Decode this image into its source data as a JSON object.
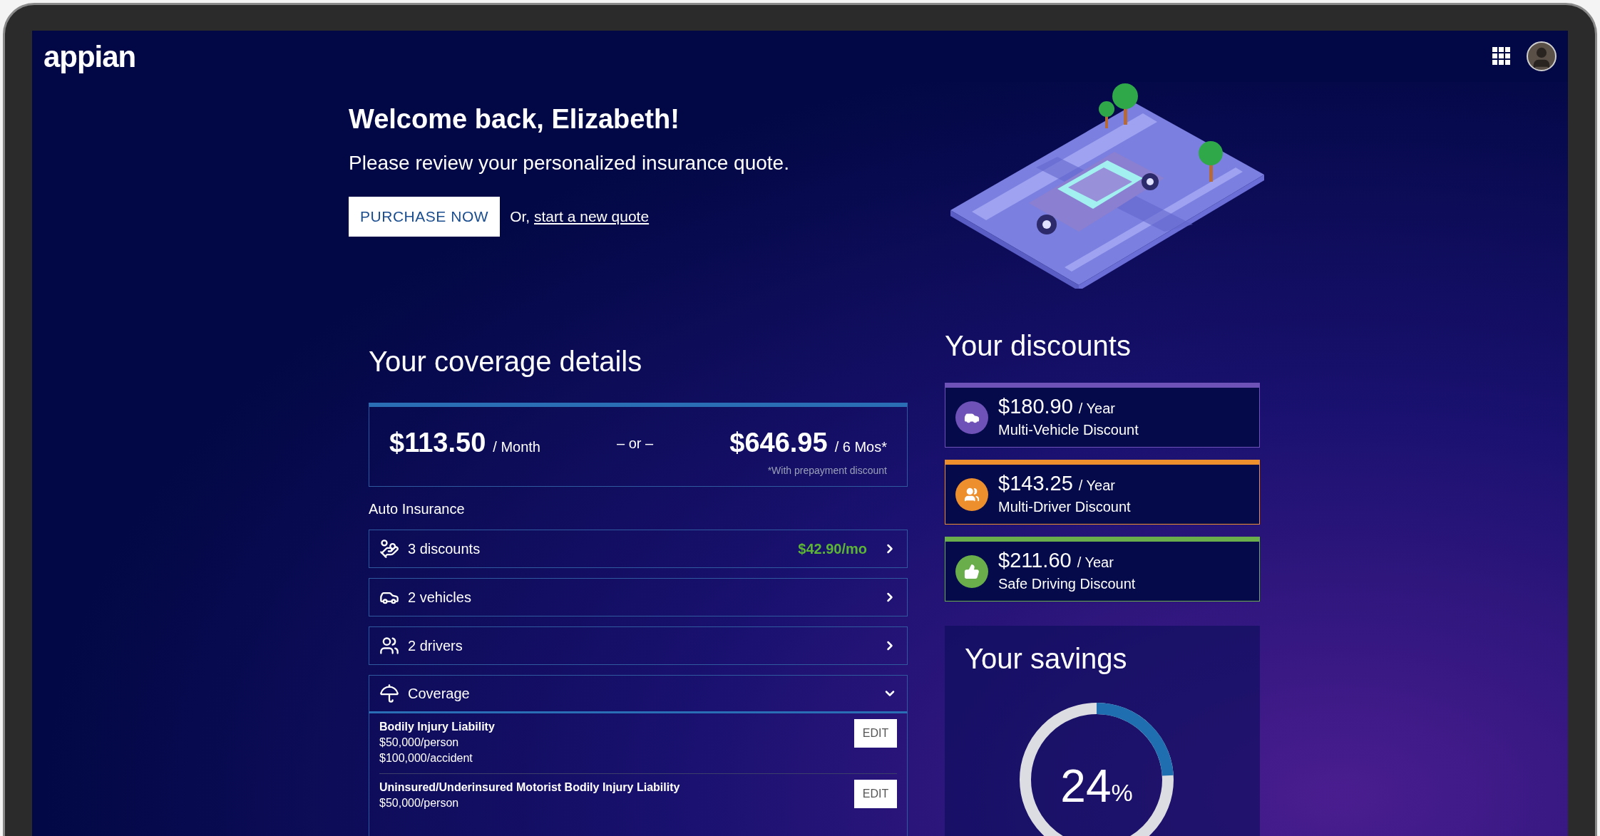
{
  "header": {
    "logo": "appian"
  },
  "hero": {
    "title": "Welcome back, Elizabeth!",
    "subtitle": "Please review your personalized insurance quote.",
    "button": "PURCHASE NOW",
    "alt_prefix": "Or,",
    "alt_link": "start a new quote"
  },
  "coverage": {
    "title": "Your coverage details",
    "price": {
      "monthly": "$113.50",
      "monthly_unit": "/ Month",
      "separator": "– or –",
      "six_month": "$646.95",
      "six_month_unit": "/ 6 Mos*",
      "note": "*With prepayment discount"
    },
    "section_label": "Auto Insurance",
    "rows": [
      {
        "kind": "discounts",
        "label": "3 discounts",
        "value": "$42.90/mo",
        "expanded": false
      },
      {
        "kind": "vehicles",
        "label": "2 vehicles",
        "expanded": false
      },
      {
        "kind": "drivers",
        "label": "2 drivers",
        "expanded": false
      },
      {
        "kind": "coverage",
        "label": "Coverage",
        "expanded": true
      }
    ],
    "items": [
      {
        "title": "Bodily Injury Liability",
        "lines": [
          "$50,000/person",
          "$100,000/accident"
        ],
        "button": "EDIT"
      },
      {
        "title": "Uninsured/Underinsured Motorist Bodily Injury Liability",
        "lines": [
          "$50,000/person"
        ],
        "button": "EDIT"
      }
    ]
  },
  "discounts": {
    "title": "Your discounts",
    "cards": [
      {
        "kind": "vehicle",
        "color": "#6f52b8",
        "amount": "$180.90",
        "unit": "/ Year",
        "label": "Multi-Vehicle Discount"
      },
      {
        "kind": "driver",
        "color": "#ee8f2e",
        "amount": "$143.25",
        "unit": "/ Year",
        "label": "Multi-Driver Discount"
      },
      {
        "kind": "safe",
        "color": "#69ae4a",
        "amount": "$211.60",
        "unit": "/ Year",
        "label": "Safe Driving Discount"
      }
    ]
  },
  "savings": {
    "title": "Your savings",
    "level": 0.24,
    "number": "24",
    "unit": "%"
  }
}
